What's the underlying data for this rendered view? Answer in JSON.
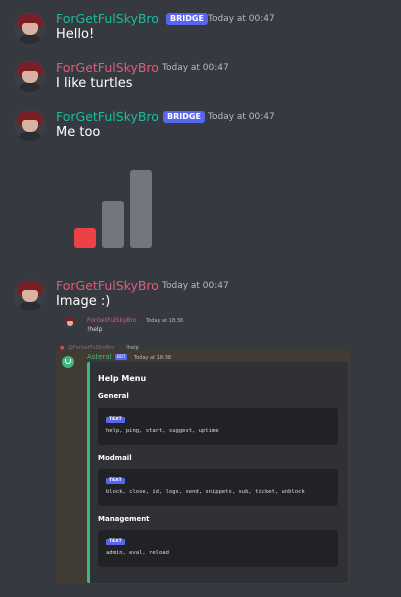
{
  "messages": [
    {
      "author": "ForGetFulSkyBro",
      "badge": "BRIDGE",
      "time": "Today at 00:47",
      "text": "Hello!"
    },
    {
      "author": "ForGetFulSkyBro",
      "time": "Today at 00:47",
      "text": "I like turtles"
    },
    {
      "author": "ForGetFulSkyBro",
      "badge": "BRIDGE",
      "time": "Today at 00:47",
      "text": "Me too"
    },
    {
      "author": "ForGetFulSkyBro",
      "time": "Today at 00:47",
      "text": "Image :)"
    }
  ],
  "bar_image": {
    "bars": [
      {
        "level": 0.25,
        "color": "#ed4245"
      },
      {
        "level": 0.6,
        "color": "#72767d"
      },
      {
        "level": 1.0,
        "color": "#72767d"
      }
    ]
  },
  "screenshot": {
    "user_author": "ForGetFulSkyBro",
    "user_time": "Today at 18:38",
    "user_text": "!help",
    "reply_ref": "@ForGetFulSkyBro",
    "reply_text": "!help",
    "bot_name": "Asteral",
    "bot_badge": "BOT",
    "bot_time": "Today at 18:38",
    "embed": {
      "title": "Help Menu",
      "fields": [
        {
          "name": "General",
          "badge": "TEXT",
          "commands": "help, ping, start, suggest, uptime"
        },
        {
          "name": "Modmail",
          "badge": "TEXT",
          "commands": "block, close, id, logs, send, snippets, sub, ticket, unblock"
        },
        {
          "name": "Management",
          "badge": "TEXT",
          "commands": "admin, eval, reload"
        }
      ]
    }
  }
}
